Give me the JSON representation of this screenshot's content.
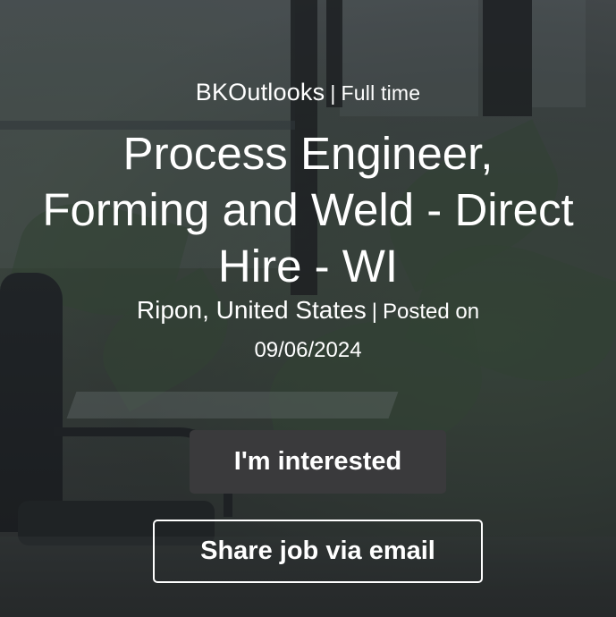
{
  "job": {
    "company": "BKOutlooks",
    "separator": "|",
    "employment_type": "Full time",
    "title": "Process Engineer, Forming and Weld - Direct Hire - WI",
    "location": "Ripon, United States",
    "posted_label": "Posted on",
    "posted_date": "09/06/2024"
  },
  "actions": {
    "interested_label": "I'm interested",
    "share_label": "Share job via email"
  },
  "colors": {
    "interested_button_bg": "#3a3a3c",
    "text": "#ffffff"
  }
}
